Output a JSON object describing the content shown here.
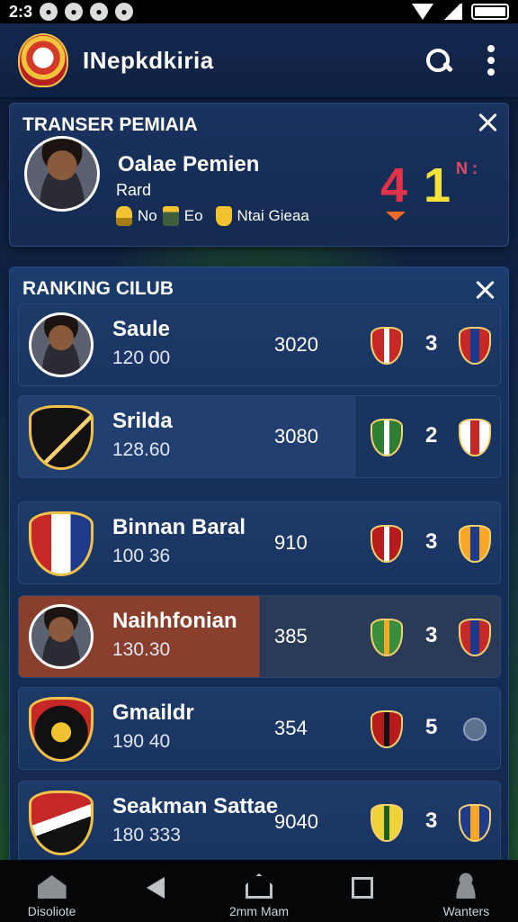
{
  "status_bar": {
    "time": "2:3"
  },
  "app_bar": {
    "title": "INepkdkiria"
  },
  "transfer_card": {
    "title": "TRANSER PEMIAIA",
    "player_name": "Oalae Pemien",
    "player_sub": "Rard",
    "stats": [
      "No",
      "Eo",
      "Ntai Gieaa"
    ],
    "score_red": "4",
    "score_yellow": "1",
    "score_small": "N :"
  },
  "ranking": {
    "title": "RANKING CILUB",
    "rows": [
      {
        "name": "Saule",
        "sub": "120 00",
        "points": "3020",
        "rank": "3",
        "highlight": "none",
        "logo": "avatar"
      },
      {
        "name": "Srilda",
        "sub": "128.60",
        "points": "3080",
        "rank": "2",
        "highlight": "blue",
        "logo": "crest"
      },
      {
        "name": "Binnan Baral",
        "sub": "100 36",
        "points": "910",
        "rank": "3",
        "highlight": "none",
        "logo": "crest"
      },
      {
        "name": "Naihhfonian",
        "sub": "130.30",
        "points": "385",
        "rank": "3",
        "highlight": "red",
        "logo": "avatar"
      },
      {
        "name": "Gmaildr",
        "sub": "190 40",
        "points": "354",
        "rank": "5",
        "highlight": "none",
        "logo": "crest"
      },
      {
        "name": "Seakman Sattae",
        "sub": "180 333",
        "points": "9040",
        "rank": "3",
        "highlight": "none",
        "logo": "crest"
      }
    ]
  },
  "nav": {
    "items": [
      {
        "label": "Disoliote",
        "icon": "home-icon"
      },
      {
        "label": "",
        "icon": "back-icon"
      },
      {
        "label": "2mm Mam",
        "icon": "house-outline-icon"
      },
      {
        "label": "",
        "icon": "recents-square-icon"
      },
      {
        "label": "Wanters",
        "icon": "person-icon"
      }
    ]
  },
  "colors": {
    "accent_red": "#e0334a",
    "accent_yellow": "#f4e33a",
    "row_red_highlight": "#8a3e2c",
    "row_blue_highlight": "#22406f",
    "panel_blue": "#16325e"
  }
}
